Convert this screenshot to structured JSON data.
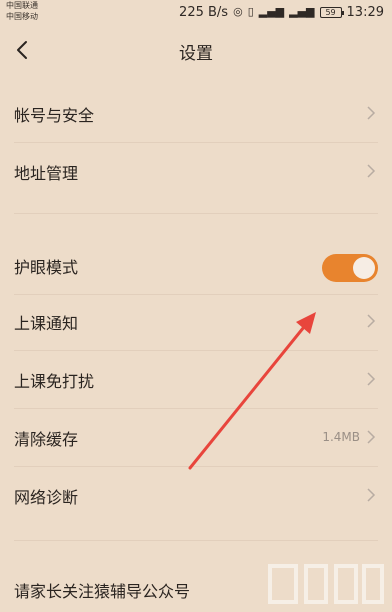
{
  "status_bar": {
    "carrier_1": "中国联通",
    "carrier_2": "中国移动",
    "speed": "225 B/s",
    "battery": "59",
    "time": "13:29"
  },
  "header": {
    "title": "设置",
    "back_icon": "chevron-left-icon"
  },
  "settings": {
    "account": {
      "label": "帐号与安全"
    },
    "address": {
      "label": "地址管理"
    },
    "eye_mode": {
      "label": "护眼模式",
      "toggle_on": true,
      "accent_color": "#e8842e"
    },
    "class_notice": {
      "label": "上课通知"
    },
    "class_dnd": {
      "label": "上课免打扰"
    },
    "clear_cache": {
      "label": "清除缓存",
      "value": "1.4MB"
    },
    "network": {
      "label": "网络诊断"
    },
    "follow": {
      "label": "请家长关注猿辅导公众号"
    }
  },
  "colors": {
    "background": "#eddcc9",
    "annotation_arrow": "#e8453c"
  }
}
